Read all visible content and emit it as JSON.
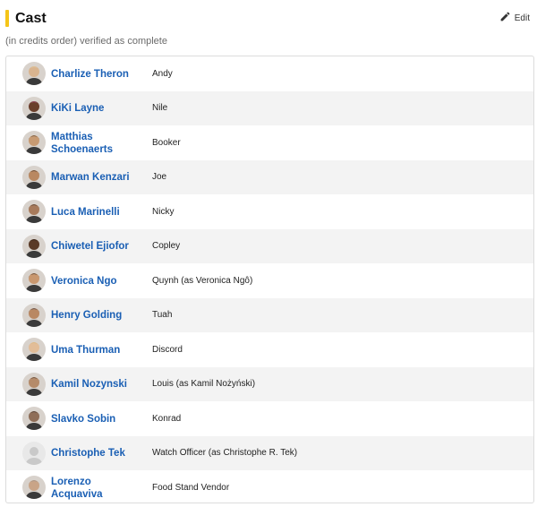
{
  "section": {
    "title": "Cast",
    "edit_label": "Edit",
    "subtitle": "(in credits order) verified as complete",
    "accent_color": "#f5c518",
    "link_color": "#1a5fb4"
  },
  "cast": [
    {
      "actor": "Charlize Theron",
      "role": "Andy",
      "avatar_color": "#d9b48f",
      "hair_color": "#e6cf9a"
    },
    {
      "actor": "KiKi Layne",
      "role": "Nile",
      "avatar_color": "#6a3f2b",
      "hair_color": "#c24b9a"
    },
    {
      "actor": "Matthias Schoenaerts",
      "role": "Booker",
      "avatar_color": "#c79a72",
      "hair_color": "#3a2a1e"
    },
    {
      "actor": "Marwan Kenzari",
      "role": "Joe",
      "avatar_color": "#b98861",
      "hair_color": "#1f1612"
    },
    {
      "actor": "Luca Marinelli",
      "role": "Nicky",
      "avatar_color": "#a77a5b",
      "hair_color": "#2b2420"
    },
    {
      "actor": "Chiwetel Ejiofor",
      "role": "Copley",
      "avatar_color": "#5a3a26",
      "hair_color": "#1b1410"
    },
    {
      "actor": "Veronica Ngo",
      "role": "Quynh (as Veronica Ngô)",
      "avatar_color": "#c8976f",
      "hair_color": "#1a1412"
    },
    {
      "actor": "Henry Golding",
      "role": "Tuah",
      "avatar_color": "#b98863",
      "hair_color": "#1d2a44"
    },
    {
      "actor": "Uma Thurman",
      "role": "Discord",
      "avatar_color": "#e2bd98",
      "hair_color": "#d9b877"
    },
    {
      "actor": "Kamil Nozynski",
      "role": "Louis (as Kamil Nożyński)",
      "avatar_color": "#b58b6a",
      "hair_color": "#2a2420"
    },
    {
      "actor": "Slavko Sobin",
      "role": "Konrad",
      "avatar_color": "#8f6e58",
      "hair_color": "#2b2623"
    },
    {
      "actor": "Christophe Tek",
      "role": "Watch Officer (as Christophe R. Tek)",
      "avatar_color": "#e3e3e3",
      "hair_color": "#c8c8c8",
      "placeholder": true
    },
    {
      "actor": "Lorenzo Acquaviva",
      "role": "Food Stand Vendor",
      "avatar_color": "#c9a487",
      "hair_color": "#8a8a8a"
    }
  ]
}
